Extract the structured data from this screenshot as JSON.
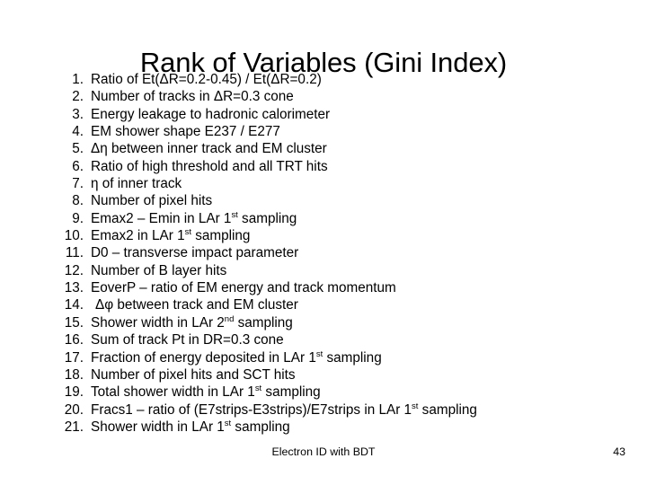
{
  "slide": {
    "title": "Rank of Variables (Gini Index)",
    "page_number": "43",
    "footer": "Electron ID with BDT"
  },
  "list": {
    "items": [
      {
        "num": "1.",
        "text_html": "Ratio of Et(ΔR=0.2-0.45) / Et(ΔR=0.2)"
      },
      {
        "num": "2.",
        "text_html": "Number of tracks in ΔR=0.3 cone"
      },
      {
        "num": "3.",
        "text_html": "Energy leakage to hadronic calorimeter"
      },
      {
        "num": "4.",
        "text_html": "EM shower shape E237 / E277"
      },
      {
        "num": "5.",
        "text_html": "Δη between inner track and EM cluster"
      },
      {
        "num": "6.",
        "text_html": "Ratio of high threshold and all TRT hits"
      },
      {
        "num": "7.",
        "text_html": "η of inner track"
      },
      {
        "num": "8.",
        "text_html": "Number of pixel hits"
      },
      {
        "num": "9.",
        "text_html": "Emax2 – Emin in LAr 1<sup>st</sup> sampling"
      },
      {
        "num": "10.",
        "text_html": "Emax2 in LAr 1<sup>st</sup> sampling"
      },
      {
        "num": "11.",
        "text_html": "D0 – transverse impact parameter"
      },
      {
        "num": "12.",
        "text_html": "Number of B layer hits"
      },
      {
        "num": "13.",
        "text_html": "EoverP – ratio of EM energy and track momentum"
      },
      {
        "num": "14.",
        "text_html": "Δφ between track and EM cluster"
      },
      {
        "num": "15.",
        "text_html": "Shower width in LAr 2<sup>nd</sup> sampling"
      },
      {
        "num": "16.",
        "text_html": "Sum of track Pt in DR=0.3 cone"
      },
      {
        "num": "17.",
        "text_html": "Fraction of energy deposited in LAr 1<sup>st</sup> sampling"
      },
      {
        "num": "18.",
        "text_html": "Number of pixel hits and SCT hits"
      },
      {
        "num": "19.",
        "text_html": "Total shower width in LAr 1<sup>st</sup> sampling"
      },
      {
        "num": "20.",
        "text_html": "Fracs1 – ratio of (E7strips-E3strips)/E7strips in LAr 1<sup>st</sup> sampling"
      },
      {
        "num": "21.",
        "text_html": "Shower width in LAr 1<sup>st</sup> sampling"
      }
    ]
  },
  "colors": {
    "background": "#ffffff",
    "text": "#000000"
  }
}
